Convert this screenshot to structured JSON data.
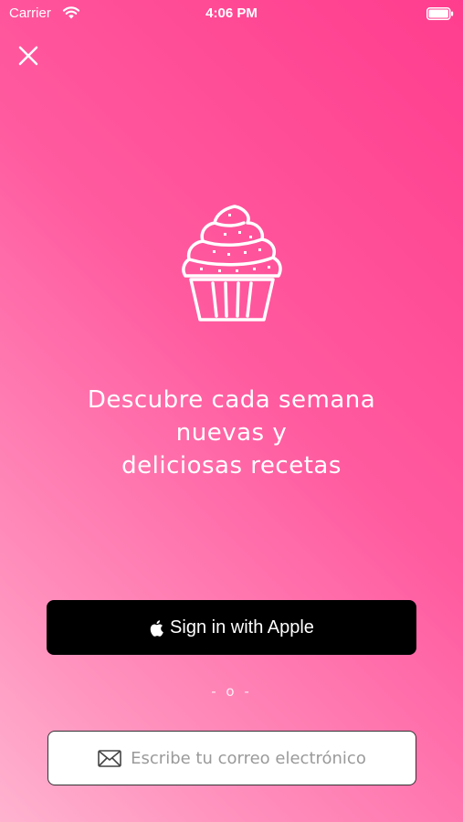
{
  "status_bar": {
    "carrier": "Carrier",
    "time": "4:06 PM"
  },
  "hero": {
    "icon": "cupcake-icon",
    "headline_lines": [
      "Descubre cada semana",
      "nuevas y",
      "deliciosas recetas"
    ]
  },
  "auth": {
    "apple_label": "Sign in with Apple",
    "divider": "- o -",
    "email_placeholder": "Escribe tu correo electrónico"
  },
  "colors": {
    "gradient_top": "#ff3d8e",
    "gradient_bottom": "#ffb3cf",
    "apple_button": "#000000",
    "text": "#ffffff"
  }
}
